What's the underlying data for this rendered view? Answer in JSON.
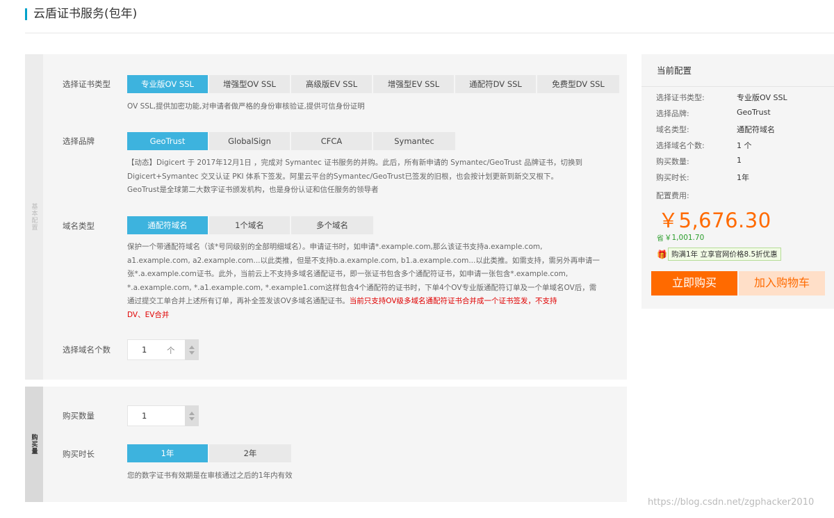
{
  "page": {
    "title": "云盾证书服务(包年)"
  },
  "basic": {
    "side_label": "基本配置",
    "cert_type": {
      "label": "选择证书类型",
      "options": [
        "专业版OV SSL",
        "增强型OV SSL",
        "高级版EV SSL",
        "增强型EV SSL",
        "通配符DV SSL",
        "免费型DV SSL"
      ],
      "selected": 0,
      "desc": "OV SSL,提供加密功能,对申请者做严格的身份审核验证,提供可信身份证明"
    },
    "brand": {
      "label": "选择品牌",
      "options": [
        "GeoTrust",
        "GlobalSign",
        "CFCA",
        "Symantec"
      ],
      "selected": 0,
      "desc_lines": [
        "【动态】Digicert 于 2017年12月1日 ，完成对 Symantec 证书服务的并购。此后，所有新申请的 Symantec/GeoTrust 品牌证书，切换到",
        "Digicert+Symantec 交叉认证 PKI 体系下签发。阿里云平台的Symantec/GeoTrust已签发的旧根，也会按计划更新到新交叉根下。",
        "GeoTrust是全球第二大数字证书颁发机构，也是身份认证和信任服务的领导者"
      ]
    },
    "domain_type": {
      "label": "域名类型",
      "options": [
        "通配符域名",
        "1个域名",
        "多个域名"
      ],
      "selected": 0,
      "desc_lines": [
        "保护一个带通配符域名（该*号同级别的全部明细域名）。申请证书时，如申请*.example.com,那么该证书支持a.example.com,",
        "a1.example.com, a2.example.com...以此类推，但是不支持b.a.example.com, b1.a.example.com...以此类推。如需支持，需另外再申请一",
        "张*.a.example.com证书。此外，当前云上不支持多域名通配证书，即一张证书包含多个通配符证书，如申请一张包含*.example.com,",
        "*.a.example.com, *.a1.example.com, *.example1.com这样包含4个通配符的证书时，下单4个OV专业版通配符订单及一个单域名OV后，需",
        "通过提交工单合并上述所有订单，再补全签发该OV多域名通配证书。"
      ],
      "warn_inline": "当前只支持OV级多域名通配符证书合并成一个证书签发，不支持",
      "warn_next": "DV、EV合并"
    },
    "domain_count": {
      "label": "选择域名个数",
      "value": "1",
      "unit": "个"
    }
  },
  "buy": {
    "side_label": "购买量",
    "quantity": {
      "label": "购买数量",
      "value": "1"
    },
    "duration": {
      "label": "购买时长",
      "options": [
        "1年",
        "2年"
      ],
      "selected": 0,
      "desc": "您的数字证书有效期是在审核通过之后的1年内有效"
    }
  },
  "config": {
    "title": "当前配置",
    "rows": [
      {
        "label": "选择证书类型:",
        "value": "专业版OV SSL"
      },
      {
        "label": "选择品牌:",
        "value": "GeoTrust"
      },
      {
        "label": "域名类型:",
        "value": "通配符域名"
      },
      {
        "label": "选择域名个数:",
        "value": "1 个"
      },
      {
        "label": "购买数量:",
        "value": "1"
      },
      {
        "label": "购买时长:",
        "value": "1年"
      }
    ],
    "fee_label": "配置费用:",
    "price": "￥5,676.30",
    "saved_icon": "省",
    "saved": "￥1,001.70",
    "promo": "购满1年 立享官网价格8.5折优惠",
    "buy_label": "立即购买",
    "cart_label": "加入购物车"
  },
  "watermark": "https://blog.csdn.net/zgphacker2010",
  "colors": {
    "accent": "#3db3de",
    "orange": "#ff6a00",
    "title_bar": "#00a2ca"
  }
}
